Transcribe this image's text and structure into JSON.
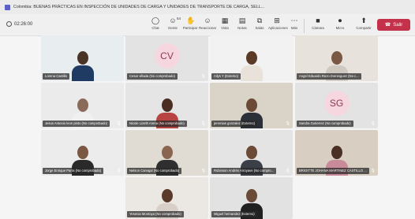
{
  "window": {
    "title": "Colombia: BUENAS PRÁCTICAS EN INSPECCIÓN DE UNIDADES DE CARGA Y UNIDADES DE TRANSPORTE DE CARGA, SELL..."
  },
  "meeting": {
    "elapsed": "02:26:00"
  },
  "toolbar": {
    "chat": "Chat",
    "people": "Gente",
    "people_count": "54",
    "raise": "Participar",
    "react": "Reaccionar",
    "view": "Vista",
    "notes": "Notas",
    "rooms": "Salas",
    "apps": "Aplicaciones",
    "more": "Más",
    "camera": "Cámara",
    "mic": "Micro",
    "share": "Compartir",
    "leave": "Salir"
  },
  "tiles": [
    {
      "name": "Lorena Castillo",
      "initials": ""
    },
    {
      "name": "Cesar villada (No comprobado)",
      "initials": "CV"
    },
    {
      "name": "Ailys Y (Externo)",
      "initials": ""
    },
    {
      "name": "Angel Eduardo Rozo Dominguez (No c...",
      "initials": ""
    },
    {
      "name": "Jesus Antonio leon pinto (No comprobado)",
      "initials": ""
    },
    {
      "name": "Nicole Lizeth Arena (No comprobado)",
      "initials": ""
    },
    {
      "name": "jeremias gonzalez (Externo)",
      "initials": ""
    },
    {
      "name": "Sandra Gutierrez (No comprobado)",
      "initials": "SG"
    },
    {
      "name": "Jorge Enrique Parra (No comprobado)",
      "initials": ""
    },
    {
      "name": "Nelson Carvajal (No comprobado)",
      "initials": ""
    },
    {
      "name": "Robinson Andrés Arroyave (No compro...",
      "initials": ""
    },
    {
      "name": "BRIGITTE JOHANA MARTINEZ CASTILLO ...",
      "initials": ""
    },
    {
      "name": "Yesenia Montoya (No comprobado)",
      "initials": ""
    },
    {
      "name": "Miguel hernandez (Externo)",
      "initials": ""
    }
  ],
  "colors": {
    "leave": "#c4314b",
    "brand": "#5b5fc7",
    "avatar_bg": "#f6d6df"
  }
}
